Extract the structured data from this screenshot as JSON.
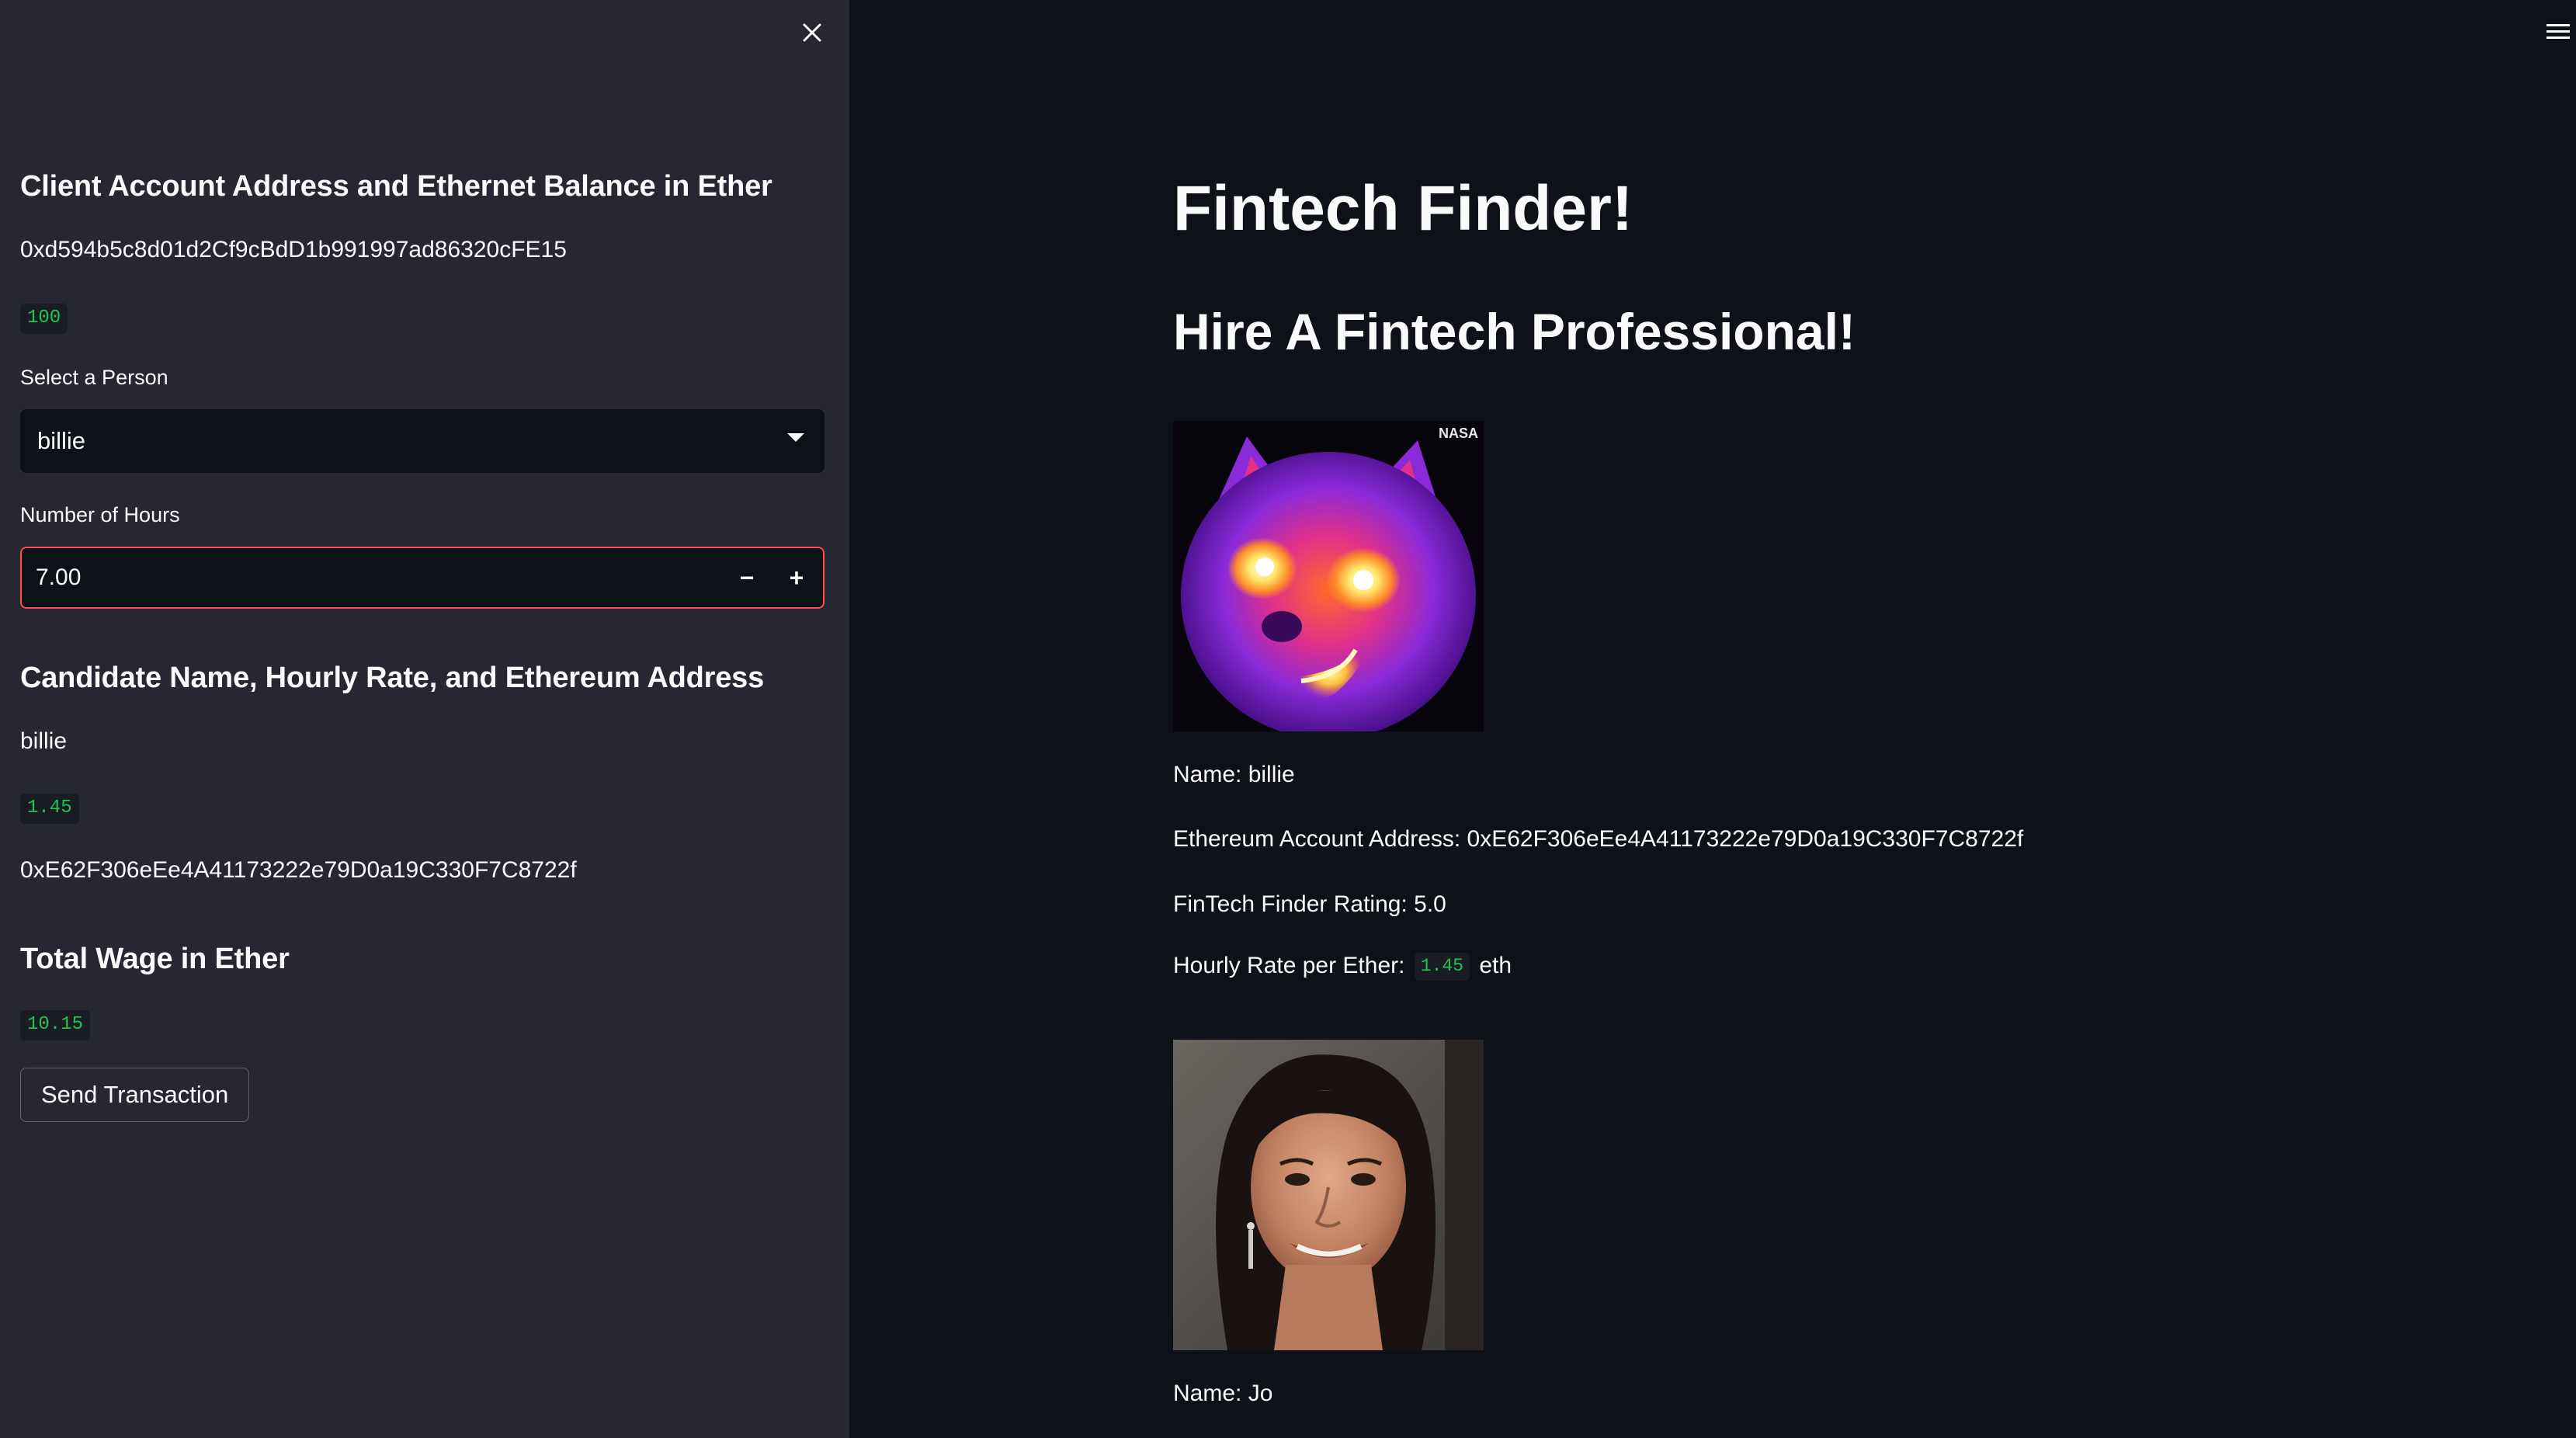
{
  "sidebar": {
    "client_heading": "Client Account Address and Ethernet Balance in Ether",
    "client_address": "0xd594b5c8d01d2Cf9cBdD1b991997ad86320cFE15",
    "client_balance": "100",
    "select_label": "Select a Person",
    "selected_person": "billie",
    "hours_label": "Number of Hours",
    "hours_value": "7.00",
    "stepper_minus": "−",
    "stepper_plus": "+",
    "candidate_heading": "Candidate Name, Hourly Rate, and Ethereum Address",
    "candidate_name": "billie",
    "candidate_rate": "1.45",
    "candidate_address": "0xE62F306eEe4A41173222e79D0a19C330F7C8722f",
    "wage_heading": "Total Wage in Ether",
    "wage_value": "10.15",
    "send_button": "Send Transaction"
  },
  "main": {
    "title": "Fintech Finder!",
    "subtitle": "Hire A Fintech Professional!",
    "candidates": [
      {
        "photo_watermark": "NASA",
        "name_line": "Name: billie",
        "address_line": "Ethereum Account Address: 0xE62F306eEe4A41173222e79D0a19C330F7C8722f",
        "rating_line": "FinTech Finder Rating: 5.0",
        "rate_prefix": "Hourly Rate per Ether:",
        "rate_value": "1.45",
        "rate_suffix": "eth"
      },
      {
        "name_line": "Name: Jo"
      }
    ]
  },
  "icons": {
    "close": "close-icon",
    "menu": "hamburger-menu-icon",
    "caret": "chevron-down-icon"
  },
  "colors": {
    "sidebar_bg": "#262730",
    "main_bg": "#0e1117",
    "accent_red": "#ff4b4b",
    "code_green": "#21c354"
  }
}
